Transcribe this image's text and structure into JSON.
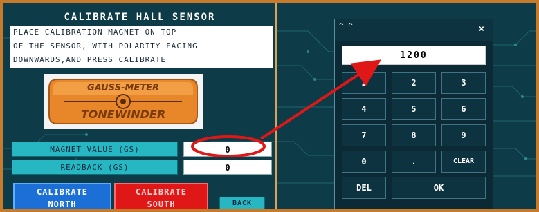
{
  "calibration": {
    "title": "CALIBRATE HALL SENSOR",
    "instructions": [
      "PLACE CALIBRATION MAGNET ON TOP",
      "OF THE SENSOR, WITH POLARITY FACING",
      "DOWNWARDS,AND PRESS CALIBRATE"
    ],
    "logo": {
      "line1": "GAUSS-METER",
      "line2": "TONEWINDER"
    },
    "magnet_value_label": "MAGNET VALUE (GS)",
    "magnet_value": "0",
    "readback_label": "READBACK (GS)",
    "readback_value": "0",
    "calibrate_north": [
      "CALIBRATE",
      "NORTH"
    ],
    "calibrate_south": [
      "CALIBRATE",
      "SOUTH"
    ],
    "back": "BACK"
  },
  "numpad": {
    "title": "^_^",
    "close": "×",
    "display": "1200",
    "keys": [
      "1",
      "2",
      "3",
      "4",
      "5",
      "6",
      "7",
      "8",
      "9",
      "0",
      ".",
      "CLEAR",
      "DEL",
      "OK"
    ]
  },
  "colors": {
    "frame": "#c67a2c",
    "background": "#0d3b47",
    "label_cyan": "#27b7c2",
    "north_blue": "#1b6fd6",
    "south_red": "#e01717",
    "highlight_red": "#e01717"
  }
}
